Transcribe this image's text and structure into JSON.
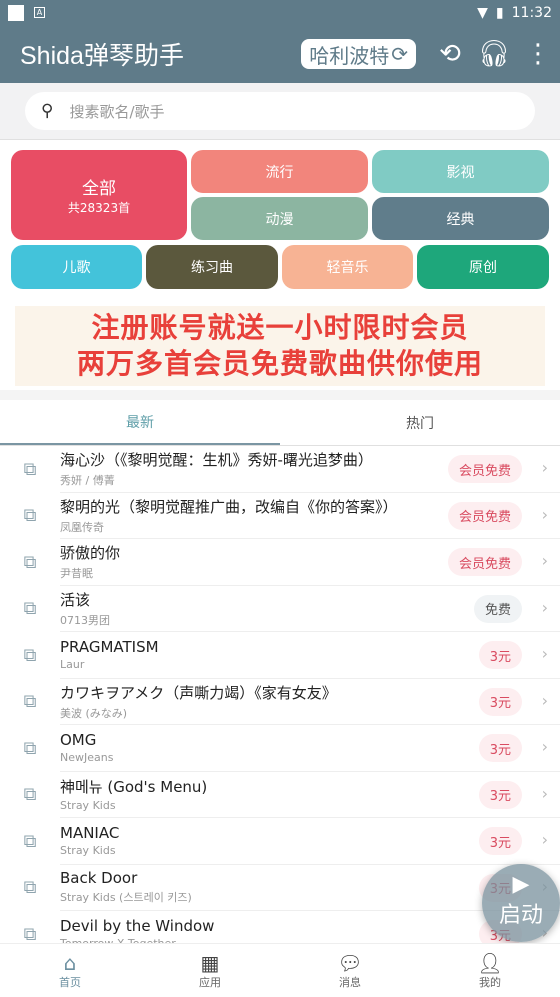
{
  "status": {
    "time": "11:32"
  },
  "appbar": {
    "title": "Shida弹琴助手",
    "song": "哈利波特",
    "icons": [
      "history-icon",
      "headphones-icon",
      "more-icon"
    ]
  },
  "search": {
    "placeholder": "搜素歌名/歌手"
  },
  "categories": {
    "all": {
      "label": "全部",
      "count": "共28323首",
      "color": "#e84d64"
    },
    "items": [
      {
        "label": "流行",
        "color": "#f2857c"
      },
      {
        "label": "影视",
        "color": "#80cbc4"
      },
      {
        "label": "动漫",
        "color": "#8cb5a1"
      },
      {
        "label": "经典",
        "color": "#607d8b"
      },
      {
        "label": "儿歌",
        "color": "#43c3da"
      },
      {
        "label": "练习曲",
        "color": "#5b583d"
      },
      {
        "label": "轻音乐",
        "color": "#f7b394"
      },
      {
        "label": "原创",
        "color": "#1ea77b"
      }
    ]
  },
  "banner": {
    "line1": "注册账号就送一小时限时会员",
    "line2": "两万多首会员免费歌曲供你使用"
  },
  "tabs": [
    {
      "label": "最新",
      "active": true
    },
    {
      "label": "热门",
      "active": false
    }
  ],
  "songs": [
    {
      "name": "海心沙（《黎明觉醒：生机》秀妍-曙光追梦曲）",
      "artist": "秀妍 / 傅菁",
      "price": "会员免费"
    },
    {
      "name": "黎明的光（黎明觉醒推广曲，改编自《你的答案》）",
      "artist": "凤凰传奇",
      "price": "会员免费"
    },
    {
      "name": "骄傲的你",
      "artist": "尹昔眠",
      "price": "会员免费"
    },
    {
      "name": "活该",
      "artist": "0713男团",
      "price": "免费"
    },
    {
      "name": "PRAGMATISM",
      "artist": "Laur",
      "price": "3元"
    },
    {
      "name": "カワキヲアメク（声嘶力竭）《家有女友》",
      "artist": "美波 (みなみ)",
      "price": "3元"
    },
    {
      "name": "OMG",
      "artist": "NewJeans",
      "price": "3元"
    },
    {
      "name": "神메뉴 (God's Menu)",
      "artist": "Stray Kids",
      "price": "3元"
    },
    {
      "name": "MANIAC",
      "artist": "Stray Kids",
      "price": "3元"
    },
    {
      "name": "Back Door",
      "artist": "Stray Kids (스트레이 키즈)",
      "price": "3元"
    },
    {
      "name": "Devil by the Window",
      "artist": "Tomorrow X Together",
      "price": "3元"
    }
  ],
  "fab": {
    "label": "启动"
  },
  "nav": [
    {
      "label": "首页",
      "icon": "home-icon",
      "active": true
    },
    {
      "label": "应用",
      "icon": "apps-icon"
    },
    {
      "label": "消息",
      "icon": "message-icon"
    },
    {
      "label": "我的",
      "icon": "person-icon"
    }
  ]
}
